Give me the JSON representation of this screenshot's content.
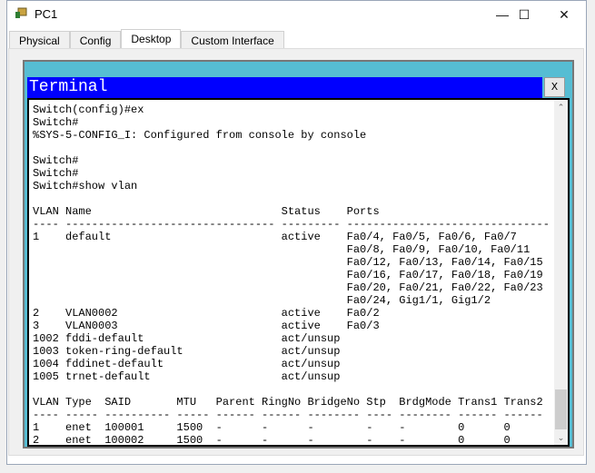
{
  "window": {
    "title": "PC1",
    "minimize": "—",
    "maximize": "☐",
    "close": "✕"
  },
  "tabs": [
    {
      "label": "Physical",
      "active": false
    },
    {
      "label": "Config",
      "active": false
    },
    {
      "label": "Desktop",
      "active": true
    },
    {
      "label": "Custom Interface",
      "active": false
    }
  ],
  "terminal": {
    "title": "Terminal",
    "close_label": "X",
    "title_color": "#0000ff",
    "frame_color": "#56bdd3",
    "lines": [
      "Switch(config)#ex",
      "Switch#",
      "%SYS-5-CONFIG_I: Configured from console by console",
      "",
      "Switch#",
      "Switch#",
      "Switch#show vlan",
      "",
      "VLAN Name                             Status    Ports",
      "---- -------------------------------- --------- -------------------------------",
      "1    default                          active    Fa0/4, Fa0/5, Fa0/6, Fa0/7",
      "                                                Fa0/8, Fa0/9, Fa0/10, Fa0/11",
      "                                                Fa0/12, Fa0/13, Fa0/14, Fa0/15",
      "                                                Fa0/16, Fa0/17, Fa0/18, Fa0/19",
      "                                                Fa0/20, Fa0/21, Fa0/22, Fa0/23",
      "                                                Fa0/24, Gig1/1, Gig1/2",
      "2    VLAN0002                         active    Fa0/2",
      "3    VLAN0003                         active    Fa0/3",
      "1002 fddi-default                     act/unsup",
      "1003 token-ring-default               act/unsup",
      "1004 fddinet-default                  act/unsup",
      "1005 trnet-default                    act/unsup",
      "",
      "VLAN Type  SAID       MTU   Parent RingNo BridgeNo Stp  BrdgMode Trans1 Trans2",
      "---- ----- ---------- ----- ------ ------ -------- ---- -------- ------ ------",
      "1    enet  100001     1500  -      -      -        -    -        0      0",
      "2    enet  100002     1500  -      -      -        -    -        0      0"
    ]
  }
}
